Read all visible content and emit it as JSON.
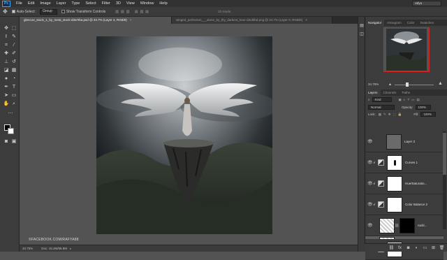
{
  "app": {
    "logo": "Ps"
  },
  "menubar": {
    "items": [
      "File",
      "Edit",
      "Image",
      "Layer",
      "Type",
      "Select",
      "Filter",
      "3D",
      "View",
      "Window",
      "Help"
    ],
    "workspace": "rafya"
  },
  "options": {
    "auto_select_label": "Auto-Select:",
    "auto_select_value": "Group",
    "transform_label": "Show Transform Controls",
    "mode_3d": "3D Mode:"
  },
  "tabs": [
    {
      "label": "glencoe_stock_1_by_meta_stock-d3a7tba.psd @ 34.7% (Layer 4, RGB/8)",
      "active": true
    },
    {
      "label": "winged_perfection___alone_by_thy_darkest_hour-d4ufdhd.png @ 34.7% (Layer 0, RGB/8)",
      "active": false
    }
  ],
  "status": {
    "zoom": "34.75%",
    "doc": "Doc: 15.4M/86.8M"
  },
  "watermark": "©FACEBOOK.COM/RAFYA88",
  "navigator": {
    "tabs": [
      "Navigator",
      "Histogram",
      "Color",
      "Swatches"
    ],
    "zoom": "34.75%"
  },
  "layers_panel": {
    "tabs": [
      "Layers",
      "Channels",
      "Paths"
    ],
    "filter_kind": "Kind",
    "blend_mode": "Normal",
    "opacity_label": "Opacity:",
    "opacity_value": "100%",
    "lock_label": "Lock:",
    "fill_label": "Fill:",
    "fill_value": "100%",
    "layers": [
      {
        "name": "Layer 3",
        "type": "pixel"
      },
      {
        "name": "Curves 1",
        "type": "adjustment"
      },
      {
        "name": "Hue/Saturatio...",
        "type": "adjustment"
      },
      {
        "name": "Color Balance 2",
        "type": "adjustment"
      },
      {
        "name": "rockl...",
        "type": "pixel"
      },
      {
        "name": "Layer 4",
        "type": "pixel",
        "selected": true
      },
      {
        "name": "Color Balance 1",
        "type": "adjustment"
      }
    ]
  },
  "colors": {
    "accent": "#31a8ff",
    "selection": "#2d6cc2",
    "nav_box": "#e02020"
  }
}
